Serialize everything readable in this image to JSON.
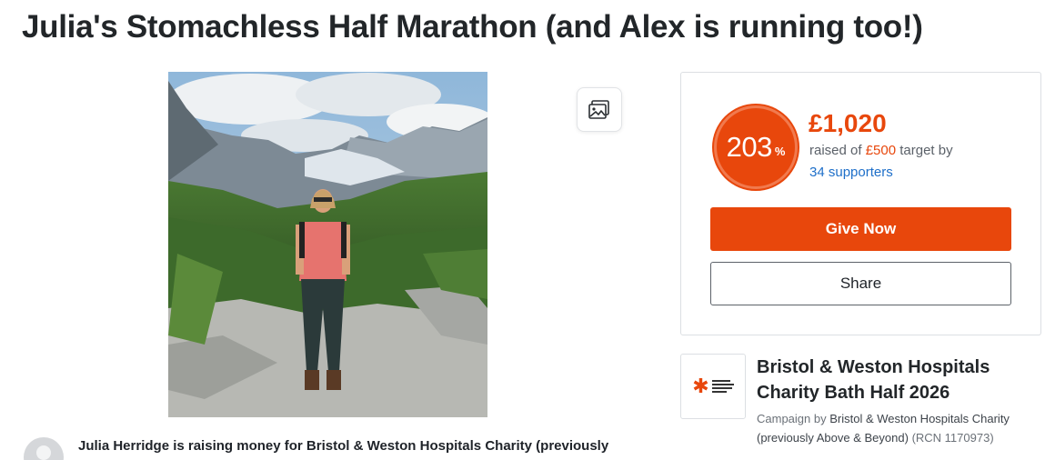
{
  "page": {
    "title": "Julia's Stomachless Half Marathon (and Alex is running too!)"
  },
  "gallery_button": {
    "icon": "image-gallery-icon"
  },
  "story": {
    "text": "Julia Herridge is raising money for Bristol & Weston Hospitals Charity (previously"
  },
  "donation": {
    "percent": "203",
    "percent_sign": "%",
    "amount_raised": "£1,020",
    "raised_prefix": "raised of ",
    "target": "£500",
    "target_suffix": " target by",
    "supporters": "34 supporters",
    "give_label": "Give Now",
    "share_label": "Share",
    "accent_color": "#e8470c"
  },
  "campaign": {
    "title": "Bristol & Weston Hospitals Charity Bath Half 2026",
    "by_prefix": "Campaign by ",
    "by_name": "Bristol & Weston Hospitals Charity (previously Above & Beyond)",
    "rcn": "(RCN 1170973)"
  }
}
